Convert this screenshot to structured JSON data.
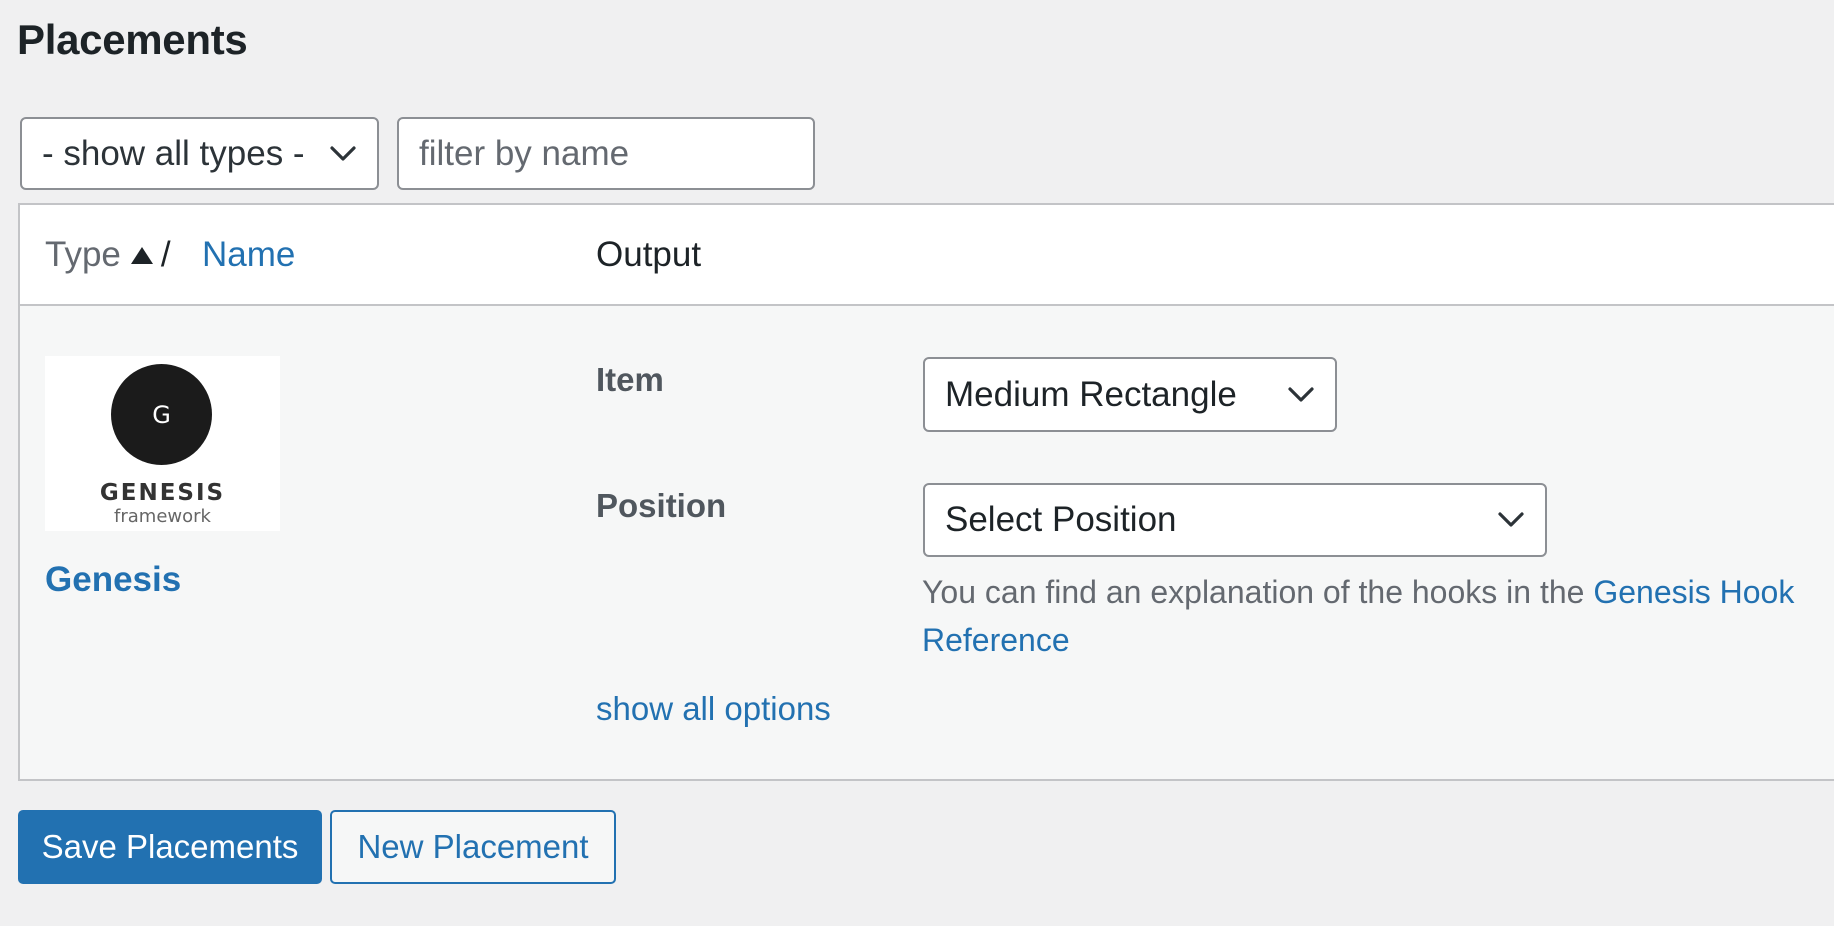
{
  "page": {
    "title": "Placements"
  },
  "filters": {
    "type_select_value": "- show all types -",
    "name_filter_placeholder": "filter by name",
    "name_filter_value": ""
  },
  "table": {
    "headers": {
      "type": "Type",
      "separator": "/",
      "name": "Name",
      "output": "Output"
    },
    "sort": {
      "column": "Type",
      "direction": "ascending",
      "icon": "sort-up-triangle-icon"
    },
    "rows": [
      {
        "logo": {
          "letter": "G",
          "word": "GENESIS",
          "sub": "framework"
        },
        "name": "Genesis",
        "item_label": "Item",
        "item_value": "Medium Rectangle",
        "position_label": "Position",
        "position_value": "Select Position",
        "help_text": "You can find an explanation of the hooks in the ",
        "help_link": "Genesis Hook Reference",
        "show_all_options": "show all options"
      }
    ]
  },
  "actions": {
    "save_label": "Save Placements",
    "new_label": "New Placement"
  },
  "colors": {
    "accent": "#2271b1",
    "background": "#f0f0f1",
    "row_background": "#f6f7f7",
    "border": "#c3c4c7"
  }
}
